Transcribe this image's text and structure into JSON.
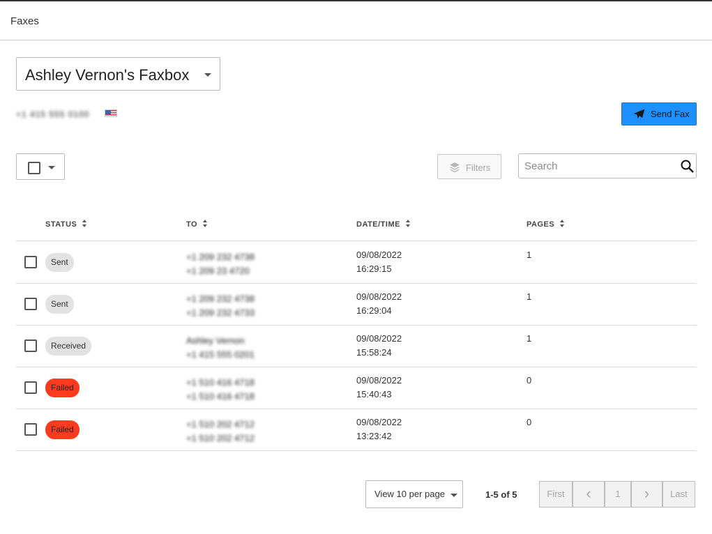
{
  "header": {
    "title": "Faxes"
  },
  "faxbox": {
    "selected": "Ashley Vernon's Faxbox",
    "number": "+1 415 555 0100"
  },
  "actions": {
    "send_fax": "Send Fax",
    "filters": "Filters"
  },
  "search": {
    "placeholder": "Search"
  },
  "table": {
    "columns": [
      "STATUS",
      "TO",
      "DATE/TIME",
      "PAGES"
    ],
    "rows": [
      {
        "status": "Sent",
        "to_line1": "+1 209 232 4738",
        "to_line2": "+1 209 23 4720",
        "date": "09/08/2022",
        "time": "16:29:15",
        "pages": "1"
      },
      {
        "status": "Sent",
        "to_line1": "+1 209 232 4738",
        "to_line2": "+1 209 232 4733",
        "date": "09/08/2022",
        "time": "16:29:04",
        "pages": "1"
      },
      {
        "status": "Received",
        "to_line1": "Ashley Vernon",
        "to_line2": "+1 415 555 0201",
        "date": "09/08/2022",
        "time": "15:58:24",
        "pages": "1"
      },
      {
        "status": "Failed",
        "to_line1": "+1 510 416 4718",
        "to_line2": "+1 510 416 4718",
        "date": "09/08/2022",
        "time": "15:40:43",
        "pages": "0"
      },
      {
        "status": "Failed",
        "to_line1": "+1 510 202 4712",
        "to_line2": "+1 510 202 4712",
        "date": "09/08/2022",
        "time": "13:23:42",
        "pages": "0"
      }
    ]
  },
  "pagination": {
    "per_page": "View 10 per page",
    "range": "1-5 of 5",
    "first": "First",
    "prev": "‹",
    "page": "1",
    "next": "›",
    "last": "Last"
  },
  "colors": {
    "accent": "#1e90ff",
    "failed": "#ff3b1f",
    "neutral_badge": "#e2e2e2"
  },
  "icons": {
    "send": "paper-plane-icon",
    "filters": "layers-icon",
    "search": "magnifier-icon",
    "flag": "us-flag-icon"
  }
}
